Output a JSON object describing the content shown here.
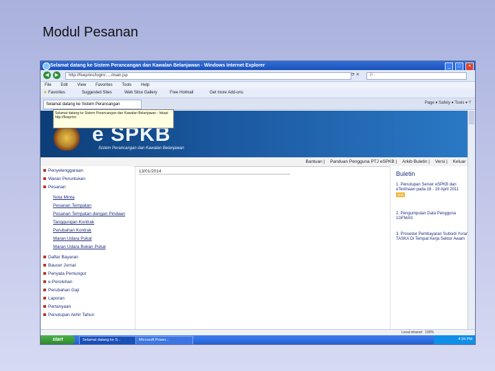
{
  "slide": {
    "title": "Modul Pesanan"
  },
  "browser": {
    "window_title": "Selamat datang ke Sistem Perancangan dan Kawalan Belanjawan - Windows Internet Explorer",
    "address": "http://fiveprinc/login/...../main.jsp",
    "search_placeholder": "P -",
    "menu": [
      "File",
      "Edit",
      "View",
      "Favorites",
      "Tools",
      "Help"
    ],
    "favorites_label": "Favorites",
    "favorites_items": [
      "Suggested Sites",
      "Web Slice Gallery",
      "Free Hotmail",
      "Get more Add-ons"
    ],
    "tab_label": "Selamat datang ke Sistem Perancangan",
    "command_bar": "Page ▾  Safety ▾  Tools ▾  ?",
    "tooltip": "Selamat datang ke Sistem Perancangan dan Kawalan Belanjawan - lokasi: http://fiveprinc"
  },
  "site": {
    "logo": "e SPKB",
    "subtitle": "Sistem Perancangan dan Kawalan Belanjawan",
    "topnav": [
      "Bantuan",
      "Panduan Pengguna PTJ eSPKB",
      "Arkib Buletin",
      "Versi",
      "Keluar"
    ],
    "date": "13/01/2014"
  },
  "sidebar": {
    "items_top": [
      "Penyelenggaraan",
      "Waran Peruntukan",
      "Pesanan"
    ],
    "sub_items": [
      "Nota Minta",
      "Pesanan Tempatan",
      "Pesanan Tempatan dengan Pindaan",
      "Tanggungan Kontrak",
      "Perubahan Kontrak",
      "Waran Udara Pukal",
      "Waran Udara Bukan Pukal"
    ],
    "items_bottom": [
      "Daftar Bayaran",
      "Baucer Jurnal",
      "Penyata Pemungut",
      "e-Perolehan",
      "Perubahan Gaji",
      "Laporan",
      "Pertanyaan",
      "Penutupan Akhir Tahun"
    ]
  },
  "bulletin": {
    "title": "Buletin",
    "items": [
      {
        "text": "1. Penutupan Server eSPKB dan eTerimaan pada 18 - 19 April 2011",
        "tag": "NEW"
      },
      {
        "text": "2. Pengumpulan Data Pengguna 1GFMAS",
        "tag": ""
      },
      {
        "text": "3. Prosedur Pembayaran Subsidi Yuran TASKA Di Tempat Kerja Sektor Awam",
        "tag": ""
      }
    ]
  },
  "status": {
    "zone": "Local intranet",
    "zoom": "100%"
  },
  "taskbar": {
    "start": "start",
    "tasks": [
      "Selamat datang ke S...",
      "Microsoft Power..."
    ],
    "clock": "4:34 PM"
  }
}
